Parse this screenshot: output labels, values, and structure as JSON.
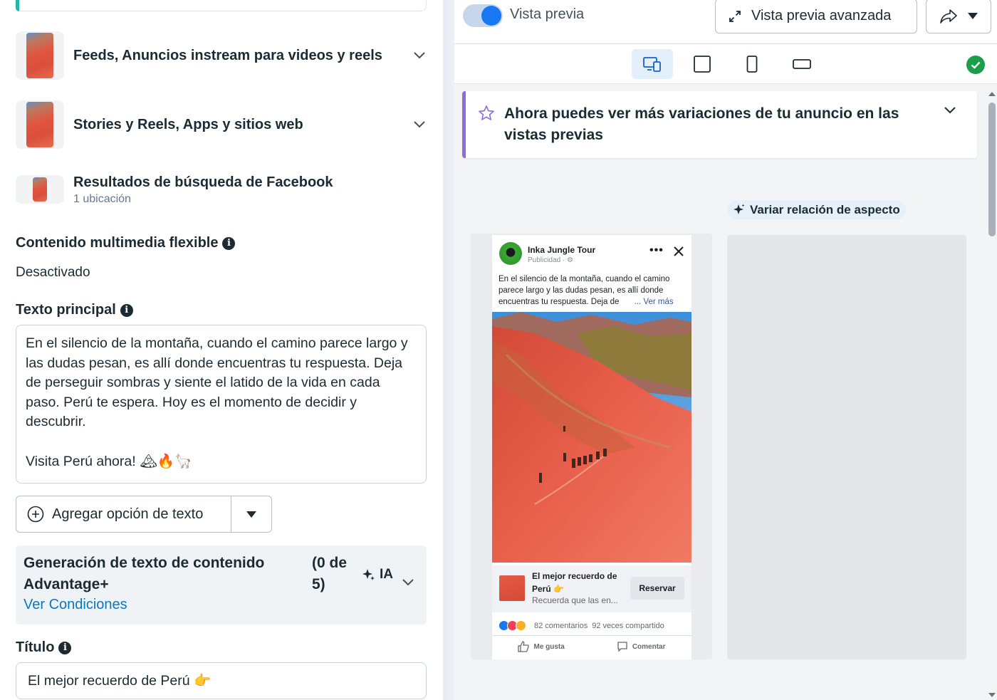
{
  "left": {
    "placements": [
      {
        "title": "Feeds, Anuncios instream para videos y reels",
        "subtitle": ""
      },
      {
        "title": "Stories y Reels, Apps y sitios web",
        "subtitle": ""
      },
      {
        "title": "Resultados de búsqueda de Facebook",
        "subtitle": "1 ubicación"
      }
    ],
    "flexible_media": {
      "label": "Contenido multimedia flexible",
      "value": "Desactivado"
    },
    "primary_text": {
      "label": "Texto principal",
      "value": "En el silencio de la montaña, cuando el camino parece largo y las dudas pesan, es allí donde encuentras tu respuesta. Deja de perseguir sombras y siente el latido de la vida en cada paso. Perú te espera. Hoy es el momento de decidir y descubrir.\n\nVisita Perú ahora! 🏔🔥🦙"
    },
    "add_text_button": "Agregar opción de texto",
    "advantage": {
      "title": "Generación de texto de contenido Advantage+",
      "count": "(0 de 5)",
      "ai_label": "IA",
      "link": "Ver Condiciones"
    },
    "title_field": {
      "label": "Título",
      "value": "El mejor recuerdo de Perú 👉"
    }
  },
  "right": {
    "toolbar": {
      "preview_toggle_label": "Vista previa",
      "preview_toggle_on": true,
      "advanced_preview_label": "Vista previa avanzada"
    },
    "devices": [
      "devices-icon",
      "square-icon",
      "phone-icon",
      "landscape-icon"
    ],
    "notice": "Ahora puedes ver más variaciones de tu anuncio en las vistas previas",
    "aspect_ratio_pill": "Variar relación de aspecto",
    "post": {
      "page_name": "Inka Jungle Tour",
      "sponsored": "Publicidad · ⚙",
      "text_lines": [
        "En el silencio de la montaña, cuando el camino",
        "parece largo y las dudas pesan, es allí donde",
        "encuentras tu respuesta. Deja de"
      ],
      "see_more": "... Ver más",
      "cta_title": "El mejor recuerdo de Perú 👉",
      "cta_subtitle": "Recuerda que las en...",
      "cta_button": "Reservar",
      "comments": "82 comentarios",
      "shares": "92 veces compartido",
      "like": "Me gusta",
      "comment": "Comentar"
    },
    "colors": {
      "accent_blue": "#1877f2",
      "success": "#1b9e4b",
      "notice_bar": "#8f6ad8"
    }
  }
}
